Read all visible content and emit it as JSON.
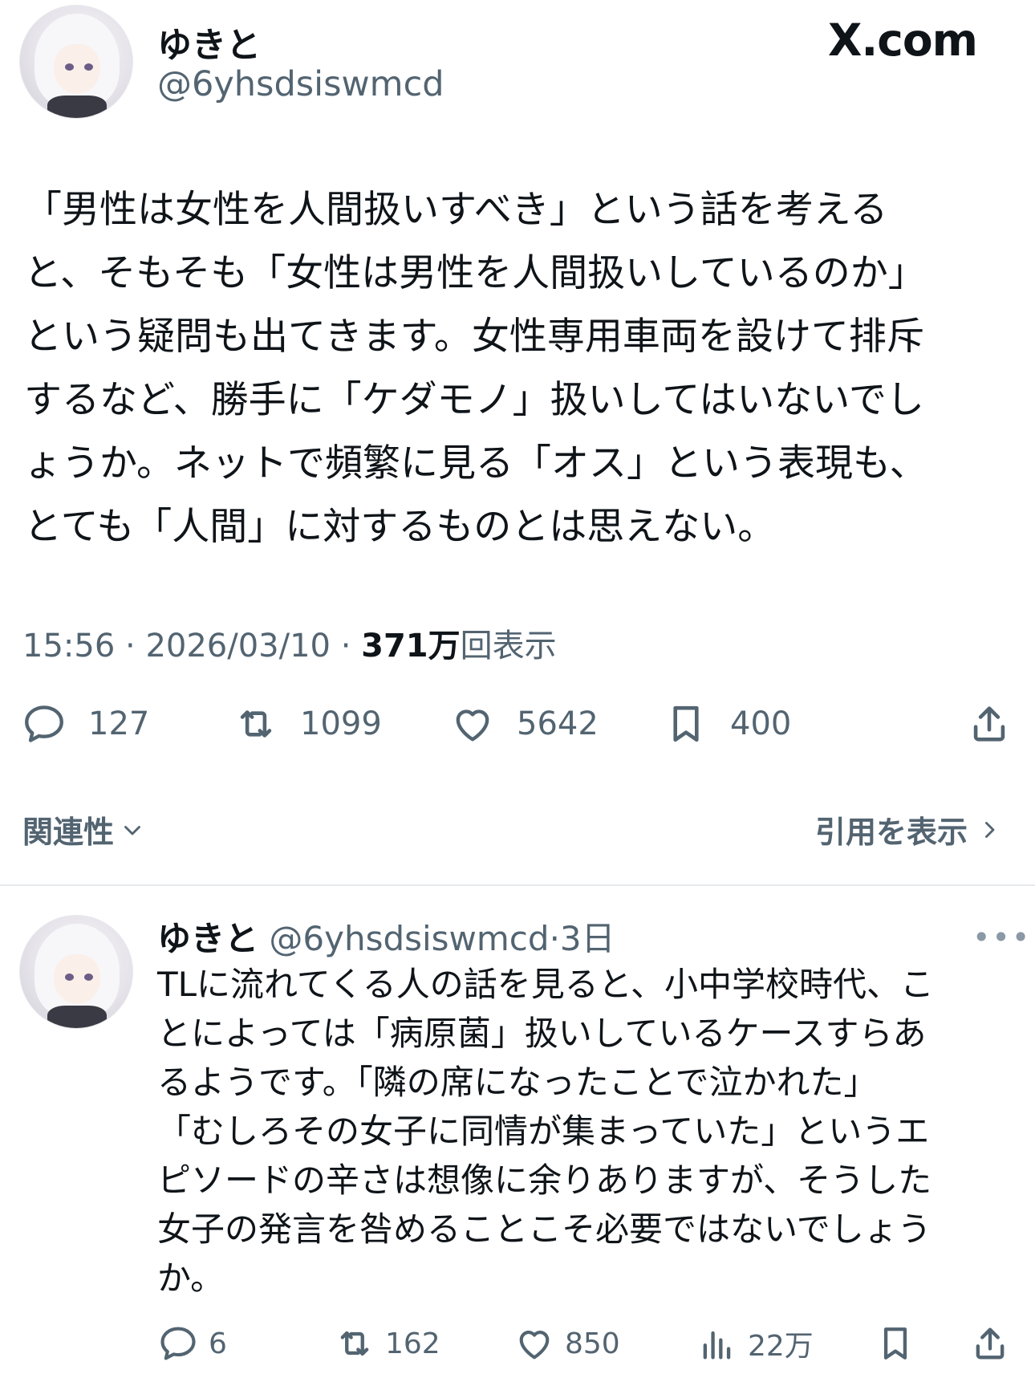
{
  "main_post": {
    "display_name": "ゆきと",
    "handle": "@6yhsdsiswmcd",
    "site_label": "X.com",
    "text": "「男性は女性を人間扱いすべき」という話を考える\nと、そもそも「女性は男性を人間扱いしているのか」\nという疑問も出てきます。女性専用車両を設けて排斥\nするなど、勝手に「ケダモノ」扱いしてはいないでし\nょうか。ネットで頻繁に見る「オス」という表現も、\nとても「人間」に対するものとは思えない。",
    "time": "15:56",
    "date": "2026/03/10",
    "views_count": "371万",
    "views_label": "回表示",
    "separator": "·",
    "actions": {
      "replies": "127",
      "reposts": "1099",
      "likes": "5642",
      "bookmarks": "400"
    },
    "icons": [
      "reply-icon",
      "repost-icon",
      "like-icon",
      "bookmark-icon",
      "share-icon"
    ]
  },
  "sort": {
    "relevance_label": "関連性",
    "view_quotes_label": "引用を表示"
  },
  "reply": {
    "display_name": "ゆきと",
    "handle": "@6yhsdsiswmcd",
    "separator": "·",
    "time_ago": "3日",
    "more": "•••",
    "text": "TLに流れてくる人の話を見ると、小中学校時代、こ\nとによっては「病原菌」扱いしているケースすらあ\nるようです。「隣の席になったことで泣かれた」\n「むしろその女子に同情が集まっていた」というエ\nピソードの辛さは想像に余りありますが、そうした\n女子の発言を咎めることこそ必要ではないでしょう\nか。",
    "actions": {
      "replies": "6",
      "reposts": "162",
      "likes": "850",
      "views": "22万"
    },
    "icons": [
      "reply-icon",
      "repost-icon",
      "like-icon",
      "views-icon",
      "bookmark-icon",
      "share-icon"
    ]
  },
  "colors": {
    "text_primary": "#0f1419",
    "text_secondary": "#536471",
    "divider": "#e6e9ec"
  }
}
